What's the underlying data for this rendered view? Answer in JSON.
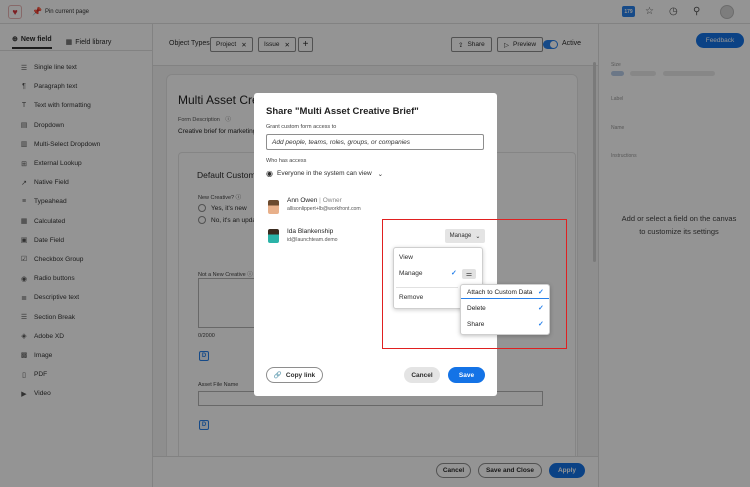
{
  "topbar": {
    "pin_label": "Pin current page",
    "badge": "179"
  },
  "left_panel": {
    "tabs": [
      {
        "label": "New field",
        "active": true
      },
      {
        "label": "Field library",
        "active": false
      }
    ],
    "fields": [
      {
        "label": "Single line text",
        "icon": "single-line-icon",
        "glyph": "☰"
      },
      {
        "label": "Paragraph text",
        "icon": "paragraph-icon",
        "glyph": "¶"
      },
      {
        "label": "Text with formatting",
        "icon": "text-format-icon",
        "glyph": "T"
      },
      {
        "label": "Dropdown",
        "icon": "dropdown-icon",
        "glyph": "▤"
      },
      {
        "label": "Multi-Select Dropdown",
        "icon": "multi-select-icon",
        "glyph": "▥"
      },
      {
        "label": "External Lookup",
        "icon": "external-lookup-icon",
        "glyph": "⊞"
      },
      {
        "label": "Native Field",
        "icon": "native-field-icon",
        "glyph": "↗"
      },
      {
        "label": "Typeahead",
        "icon": "typeahead-icon",
        "glyph": "≡"
      },
      {
        "label": "Calculated",
        "icon": "calculated-icon",
        "glyph": "▦"
      },
      {
        "label": "Date Field",
        "icon": "calendar-icon",
        "glyph": "▣"
      },
      {
        "label": "Checkbox Group",
        "icon": "checkbox-icon",
        "glyph": "☑"
      },
      {
        "label": "Radio buttons",
        "icon": "radio-icon",
        "glyph": "◉"
      },
      {
        "label": "Descriptive text",
        "icon": "descriptive-text-icon",
        "glyph": "≣"
      },
      {
        "label": "Section Break",
        "icon": "section-break-icon",
        "glyph": "☰"
      },
      {
        "label": "Adobe XD",
        "icon": "adobe-xd-icon",
        "glyph": "◈"
      },
      {
        "label": "Image",
        "icon": "image-icon",
        "glyph": "▩"
      },
      {
        "label": "PDF",
        "icon": "pdf-icon",
        "glyph": "▯"
      },
      {
        "label": "Video",
        "icon": "video-icon",
        "glyph": "▶"
      }
    ]
  },
  "header": {
    "object_types_label": "Object Types",
    "chips": [
      "Project",
      "Issue"
    ],
    "share_label": "Share",
    "preview_label": "Preview",
    "active_label": "Active"
  },
  "canvas": {
    "form_title": "Multi Asset Crea",
    "form_description_label": "Form Description",
    "form_description": "Creative brief for marketing",
    "section_title": "Default Custom",
    "new_creative_label": "New Creative?",
    "options": [
      "Yes, it's new",
      "No, it's an upda"
    ],
    "not_new_label": "Not a New Creative",
    "char_count": "0/2000",
    "asset_file_label": "Asset File Name"
  },
  "bottom": {
    "cancel": "Cancel",
    "save_close": "Save and Close",
    "apply": "Apply"
  },
  "right_panel": {
    "feedback": "Feedback",
    "size_label": "Size",
    "label_label": "Label",
    "name_label": "Name",
    "instructions_label": "Instructions",
    "hint": "Add or select a field on the canvas to customize its settings"
  },
  "dialog": {
    "title": "Share \"Multi Asset Creative Brief\"",
    "grant_label": "Grant custom form access to",
    "input_placeholder": "Add people, teams, roles, groups, or companies",
    "who_label": "Who has access",
    "everyone_label": "Everyone in the system can view",
    "users": [
      {
        "name": "Ann Owen",
        "role": "Owner",
        "email": "allisonlippert+lb@workfront.com"
      },
      {
        "name": "Ida Blankenship",
        "role": "",
        "email": "id@launchteam.demo"
      }
    ],
    "manage_label": "Manage",
    "menu": {
      "view": "View",
      "manage": "Manage",
      "remove": "Remove"
    },
    "submenu": [
      "Attach to Custom Data",
      "Delete",
      "Share"
    ],
    "copy_link": "Copy link",
    "cancel": "Cancel",
    "save": "Save"
  },
  "colors": {
    "accent": "#1473e6",
    "highlight": "#e02020",
    "brand": "#d7373f"
  }
}
